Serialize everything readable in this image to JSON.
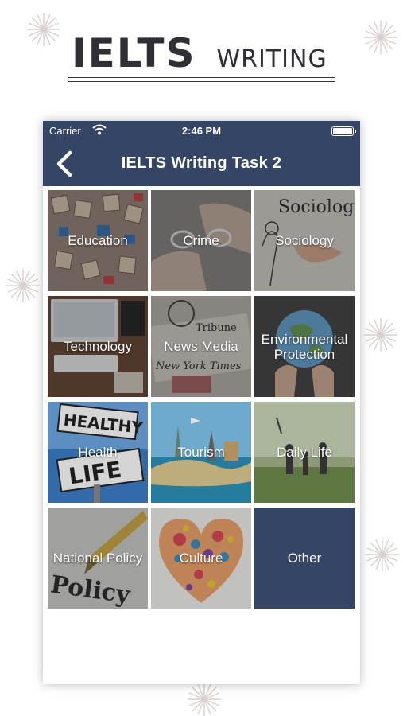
{
  "promo": {
    "title_big": "IELTS",
    "title_small": "WRITING"
  },
  "status_bar": {
    "carrier": "Carrier",
    "time": "2:46 PM"
  },
  "nav": {
    "title": "IELTS Writing Task 2",
    "back_icon": "chevron-left-icon"
  },
  "colors": {
    "nav_bg": "#344565",
    "other_tile_bg": "#344565"
  },
  "topics": [
    {
      "label": "Education",
      "icon": "scrabble-tiles-image"
    },
    {
      "label": "Crime",
      "icon": "handcuffs-image"
    },
    {
      "label": "Sociology",
      "icon": "handshake-sketch-image"
    },
    {
      "label": "Technology",
      "icon": "computer-desk-image"
    },
    {
      "label": "News Media",
      "icon": "newspapers-image"
    },
    {
      "label": "Environmental\nProtection",
      "icon": "globe-in-hands-image"
    },
    {
      "label": "Health",
      "icon": "healthy-life-sign-image"
    },
    {
      "label": "Tourism",
      "icon": "world-landmarks-image"
    },
    {
      "label": "Daily Life",
      "icon": "family-walking-image"
    },
    {
      "label": "National Policy",
      "icon": "fountain-pen-policy-image"
    },
    {
      "label": "Culture",
      "icon": "culture-heart-image"
    },
    {
      "label": "Other",
      "icon": "none"
    }
  ]
}
